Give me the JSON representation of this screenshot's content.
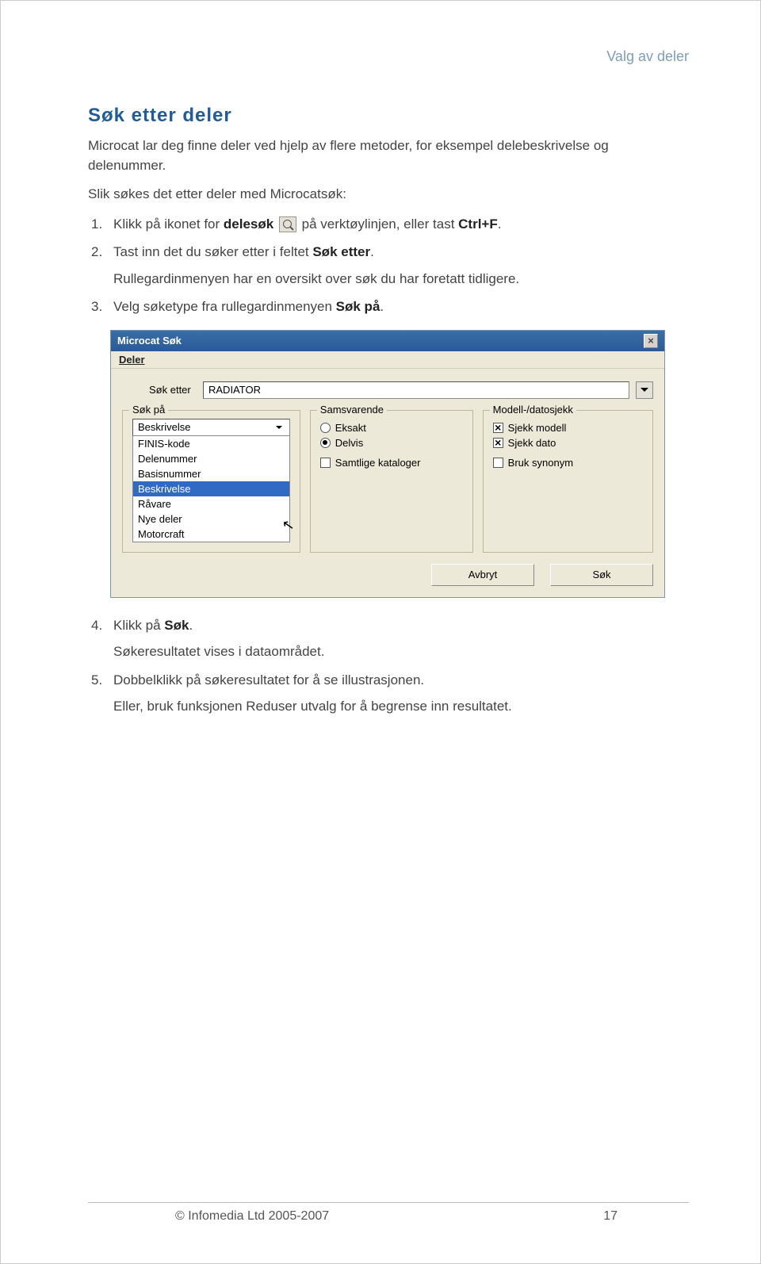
{
  "header": {
    "section": "Valg av deler"
  },
  "title": "Søk etter deler",
  "intro": "Microcat lar deg finne deler ved hjelp av flere metoder, for eksempel delebeskrivelse og delenummer.",
  "lead": "Slik søkes det etter deler med Microcatsøk:",
  "steps": {
    "s1a": "Klikk på ikonet for ",
    "s1b_bold": "delesøk",
    "s1c": " på verktøylinjen, eller tast ",
    "s1d_bold": "Ctrl+F",
    "s1e": ".",
    "s2a": "Tast inn det du søker etter i feltet ",
    "s2b_bold": "Søk etter",
    "s2c": ".",
    "s2_sub": "Rullegardinmenyen har en oversikt over søk du har foretatt tidligere.",
    "s3a": "Velg søketype fra rullegardinmenyen ",
    "s3b_bold": "Søk på",
    "s3c": ".",
    "s4a": "Klikk på ",
    "s4b_bold": "Søk",
    "s4c": ".",
    "s4_sub": "Søkeresultatet vises i dataområdet.",
    "s5": "Dobbelklikk på søkeresultatet for å se illustrasjonen.",
    "s5_sub": "Eller, bruk funksjonen Reduser utvalg for å begrense inn resultatet."
  },
  "shot": {
    "title": "Microcat Søk",
    "menu": "Deler",
    "search_label": "Søk etter",
    "search_value": "RADIATOR",
    "grp_sokpa": "Søk på",
    "combo_selected": "Beskrivelse",
    "combo_options": [
      "FINIS-kode",
      "Delenummer",
      "Basisnummer",
      "Beskrivelse",
      "Råvare",
      "Nye deler",
      "Motorcraft"
    ],
    "grp_sams": "Samsvarende",
    "r_eksakt": "Eksakt",
    "r_delvis": "Delvis",
    "c_samtlige": "Samtlige kataloger",
    "grp_modell": "Modell-/datosjekk",
    "c_sjekkmodell": "Sjekk modell",
    "c_sjekkdato": "Sjekk dato",
    "c_bruksyn": "Bruk synonym",
    "btn_cancel": "Avbryt",
    "btn_search": "Søk"
  },
  "footer": {
    "copyright": "© Infomedia Ltd 2005-2007",
    "page": "17"
  }
}
